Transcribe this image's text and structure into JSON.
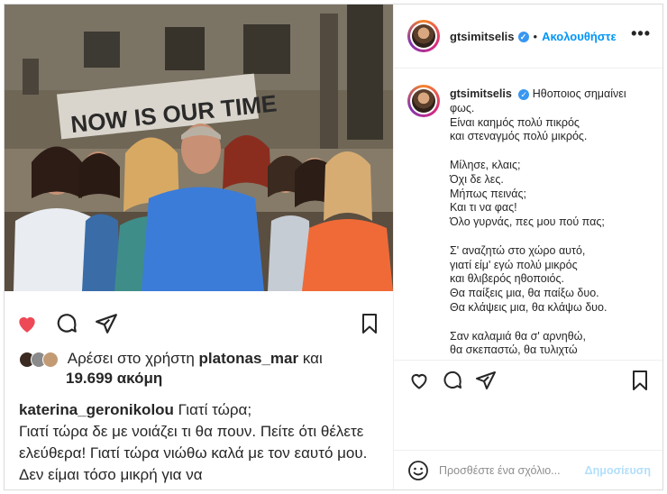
{
  "photo": {
    "wall_text": "NOW IS OUR TIME",
    "description_icon": "photo-cast-image"
  },
  "left_panel": {
    "liked_by_prefix": "Αρέσει στο χρήστη",
    "liked_by_user": "platonas_mar",
    "liked_by_and": "και",
    "likes_others": "19.699 ακόμη",
    "caption_user": "katerina_geronikolou",
    "caption_first": "Γιατί τώρα;",
    "caption_body": "Γιατί τώρα δε με νοιάζει τι θα πουν. Πείτε ότι θέλετε ελεύθερα! Γιατί τώρα νιώθω καλά με τον εαυτό μου. Δεν είμαι τόσο μικρή για να"
  },
  "header": {
    "username": "gtsimitselis",
    "verified": "✓",
    "separator": "•",
    "follow_label": "Ακολουθήστε",
    "more_label": "•••"
  },
  "comment": {
    "username": "gtsimitselis",
    "first_line": "Ηθοποιος σημαίνει",
    "lines": [
      "φως.",
      "Είναι καημός πολύ πικρός",
      "και στεναγμός πολύ μικρός.",
      "",
      "Μίλησε, κλαις;",
      "Όχι δε λες.",
      "Μήπως πεινάς;",
      "Και τι να φας!",
      "Όλο γυρνάς, πες μου πού πας;",
      "",
      "Σ' αναζητώ στο χώρο αυτό,",
      "γιατί είμ' εγώ πολύ μικρός",
      "και θλιβερός ηθοποιός.",
      "Θα παίξεις μια, θα παίξω δυο.",
      "Θα κλάψεις μια, θα κλάψω δυο.",
      "",
      "Σαν καλαμιά θα σ' αρνηθώ,",
      "θα σκεπαστώ, θα τυλιχτώ"
    ]
  },
  "add_comment": {
    "placeholder": "Προσθέστε ένα σχόλιο...",
    "post_label": "Δημοσίευση"
  },
  "colors": {
    "like_red": "#ed4956",
    "link_blue": "#0095f6",
    "verified_blue": "#3897f0",
    "post_disabled": "#b2dffc"
  }
}
